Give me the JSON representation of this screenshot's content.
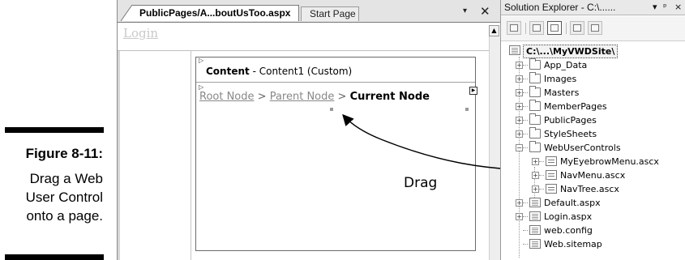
{
  "caption": {
    "title": "Figure 8-11:",
    "body_lines": [
      "Drag a Web",
      "User Control",
      "onto a page."
    ]
  },
  "editor": {
    "tabs": [
      {
        "label": "PublicPages/A...boutUsToo.aspx",
        "active": true
      },
      {
        "label": "Start Page",
        "active": false
      }
    ],
    "dropdown_glyph": "▾",
    "close_glyph": "✕",
    "login_text": "Login",
    "content_region": {
      "name": "Content",
      "detail": "- Content1 (Custom)"
    },
    "breadcrumb": {
      "root": "Root Node",
      "parent": "Parent Node",
      "current": "Current Node",
      "separator": ">"
    },
    "annotation": "Drag"
  },
  "solution_explorer": {
    "title": "Solution Explorer - C:\\...... ",
    "title_controls": [
      "▾",
      "ᵖ",
      "×"
    ],
    "root": "C:\\...\\MyVWDSite\\",
    "items": [
      {
        "label": "App_Data",
        "type": "folder",
        "expand": "+"
      },
      {
        "label": "Images",
        "type": "folder",
        "expand": "+"
      },
      {
        "label": "Masters",
        "type": "folder",
        "expand": "+"
      },
      {
        "label": "MemberPages",
        "type": "folder",
        "expand": "+"
      },
      {
        "label": "PublicPages",
        "type": "folder",
        "expand": "+"
      },
      {
        "label": "StyleSheets",
        "type": "folder",
        "expand": "+"
      },
      {
        "label": "WebUserControls",
        "type": "folder-open",
        "expand": "−"
      },
      {
        "label": "MyEyebrowMenu.ascx",
        "type": "ascx",
        "expand": "+",
        "child": true
      },
      {
        "label": "NavMenu.ascx",
        "type": "ascx",
        "expand": "+",
        "child": true
      },
      {
        "label": "NavTree.ascx",
        "type": "ascx",
        "expand": "+",
        "child": true
      },
      {
        "label": "Default.aspx",
        "type": "page",
        "expand": "+"
      },
      {
        "label": "Login.aspx",
        "type": "page",
        "expand": "+"
      },
      {
        "label": "web.config",
        "type": "config",
        "expand": ""
      },
      {
        "label": "Web.sitemap",
        "type": "sitemap",
        "expand": ""
      }
    ]
  }
}
